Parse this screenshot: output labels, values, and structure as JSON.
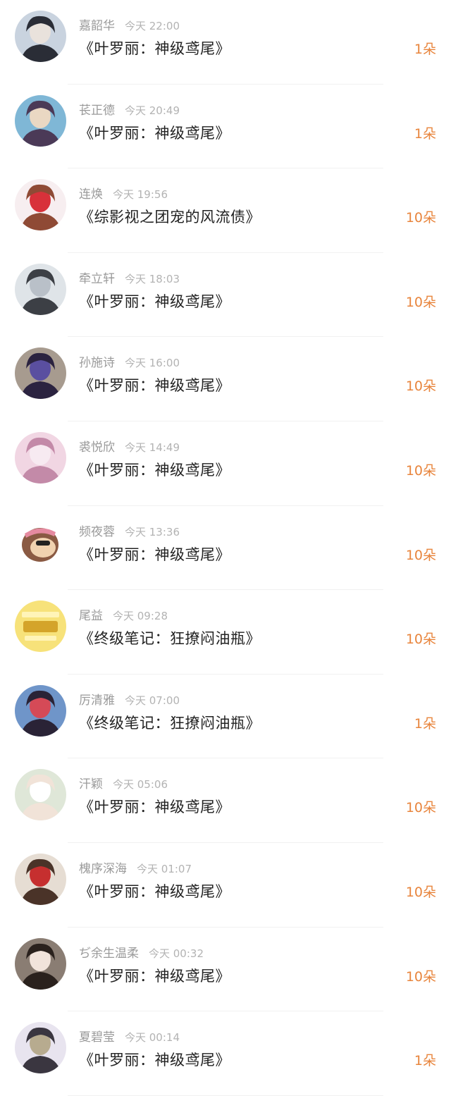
{
  "colors": {
    "name": "#9a9a9a",
    "time": "#b3b3b3",
    "title": "#222222",
    "count": "#e8853d",
    "divider": "#f1f1f1"
  },
  "items": [
    {
      "name": "嘉韶华",
      "time": "今天 22:00",
      "title": "《叶罗丽：神级鸢尾》",
      "count": "1朵",
      "avatar": {
        "bg": "#c9d3df",
        "fg": "#2a2d36",
        "accent": "#e9e2dc",
        "icon": "portrait-man-icon"
      }
    },
    {
      "name": "苌正德",
      "time": "今天 20:49",
      "title": "《叶罗丽：神级鸢尾》",
      "count": "1朵",
      "avatar": {
        "bg": "#7fb7d6",
        "fg": "#4b3a57",
        "accent": "#ead8c3",
        "icon": "portrait-woman-icon"
      }
    },
    {
      "name": "连焕",
      "time": "今天 19:56",
      "title": "《综影视之团宠的风流债》",
      "count": "10朵",
      "avatar": {
        "bg": "#f7eef0",
        "fg": "#8f4a35",
        "accent": "#d8313a",
        "icon": "anime-girl-icon"
      }
    },
    {
      "name": "牵立轩",
      "time": "今天 18:03",
      "title": "《叶罗丽：神级鸢尾》",
      "count": "10朵",
      "avatar": {
        "bg": "#dfe4e8",
        "fg": "#3c3f45",
        "accent": "#b9c0c8",
        "icon": "portrait-man-icon"
      }
    },
    {
      "name": "孙施诗",
      "time": "今天 16:00",
      "title": "《叶罗丽：神级鸢尾》",
      "count": "10朵",
      "avatar": {
        "bg": "#a79b8f",
        "fg": "#2b2340",
        "accent": "#5a4fa0",
        "icon": "portrait-woman-icon"
      }
    },
    {
      "name": "裘悦欣",
      "time": "今天 14:49",
      "title": "《叶罗丽：神级鸢尾》",
      "count": "10朵",
      "avatar": {
        "bg": "#f1d6e3",
        "fg": "#c38aa8",
        "accent": "#f7eaf1",
        "icon": "portrait-woman-icon"
      }
    },
    {
      "name": "频夜蓉",
      "time": "今天 13:36",
      "title": "《叶罗丽：神级鸢尾》",
      "count": "10朵",
      "avatar": {
        "bg": "#ffffff",
        "fg": "#8a5a43",
        "accent": "#e58aa0",
        "icon": "sloth-cartoon-icon"
      }
    },
    {
      "name": "尾益",
      "time": "今天 09:28",
      "title": "《终级笔记：狂撩闷油瓶》",
      "count": "10朵",
      "avatar": {
        "bg": "#f7e27a",
        "fg": "#d4a42a",
        "accent": "#fff4b8",
        "icon": "tnt-badge-icon"
      }
    },
    {
      "name": "厉清雅",
      "time": "今天 07:00",
      "title": "《终级笔记：狂撩闷油瓶》",
      "count": "1朵",
      "avatar": {
        "bg": "#6f95c9",
        "fg": "#2a2336",
        "accent": "#d54a57",
        "icon": "anime-girl-icon"
      }
    },
    {
      "name": "汗颖",
      "time": "今天 05:06",
      "title": "《叶罗丽：神级鸢尾》",
      "count": "10朵",
      "avatar": {
        "bg": "#dfe7d8",
        "fg": "#f1e3d8",
        "accent": "#ffffff",
        "icon": "portrait-woman-icon"
      }
    },
    {
      "name": "槐序深海",
      "time": "今天 01:07",
      "title": "《叶罗丽：神级鸢尾》",
      "count": "10朵",
      "avatar": {
        "bg": "#e6ddd3",
        "fg": "#4a3328",
        "accent": "#c62f2f",
        "icon": "anime-girl-icon"
      }
    },
    {
      "name": "ぢ余生温柔",
      "time": "今天 00:32",
      "title": "《叶罗丽：神级鸢尾》",
      "count": "10朵",
      "avatar": {
        "bg": "#8a7d73",
        "fg": "#2a211d",
        "accent": "#f1e3db",
        "icon": "portrait-woman-icon"
      }
    },
    {
      "name": "夏碧莹",
      "time": "今天 00:14",
      "title": "《叶罗丽：神级鸢尾》",
      "count": "1朵",
      "avatar": {
        "bg": "#e8e4ef",
        "fg": "#3a3640",
        "accent": "#b7ab8f",
        "icon": "portrait-man-icon"
      }
    }
  ]
}
